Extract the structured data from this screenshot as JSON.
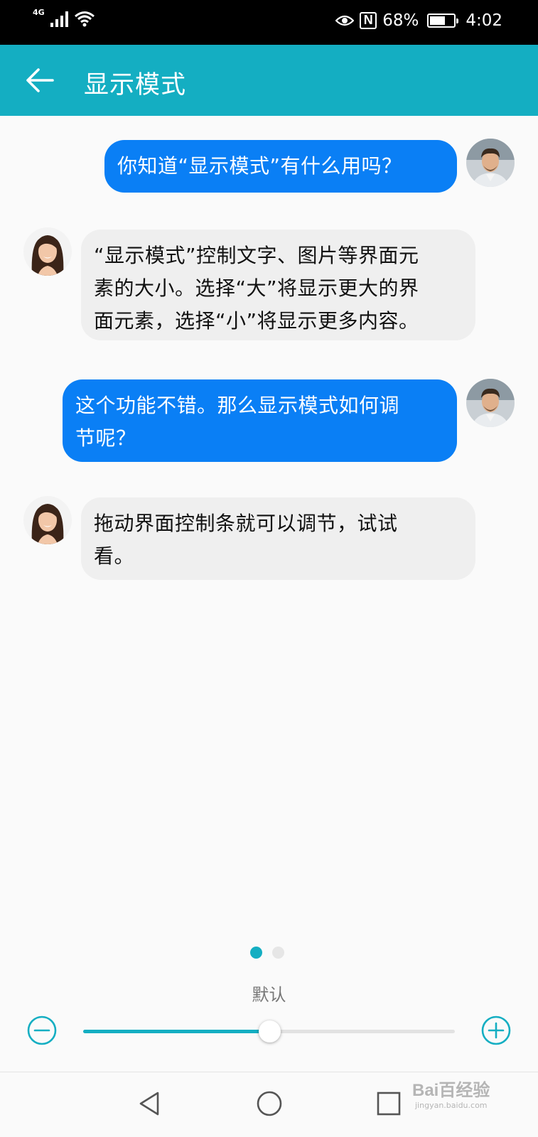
{
  "status_bar": {
    "network": "4G",
    "battery": "68%",
    "battery_level": 0.68,
    "time": "4:02",
    "icons": [
      "signal-icon",
      "wifi-icon",
      "eye-comfort-icon",
      "nfc-icon",
      "battery-icon"
    ]
  },
  "app_bar": {
    "title": "显示模式",
    "back_icon": "arrow-left-icon"
  },
  "messages": [
    {
      "sender": "user",
      "text": "你知道“显示模式”有什么用吗？"
    },
    {
      "sender": "assistant",
      "lines": [
        "“显示模式”控制文字、图片等界面元",
        "素的大小。选择“大”将显示更大的界",
        "面元素，选择“小”将显示更多内容。"
      ]
    },
    {
      "sender": "user",
      "lines": [
        "这个功能不错。那么显示模式如何调",
        "节呢？"
      ]
    },
    {
      "sender": "assistant",
      "lines": [
        "拖动界面控制条就可以调节，试试",
        "看。"
      ]
    }
  ],
  "pager": {
    "current": 1,
    "total": 2
  },
  "size_control": {
    "label": "默认",
    "level": 0.5,
    "minus_icon": "minus-circle-icon",
    "plus_icon": "plus-circle-icon"
  },
  "nav_bar": {
    "icons": [
      "back-triangle-icon",
      "home-circle-icon",
      "recents-square-icon"
    ]
  },
  "watermark": {
    "logo": "Bai百经验",
    "url": "jingyan.baidu.com"
  },
  "colors": {
    "accent": "#14aec2",
    "user_bubble": "#0a7ff5",
    "assistant_bubble": "#efefef"
  }
}
